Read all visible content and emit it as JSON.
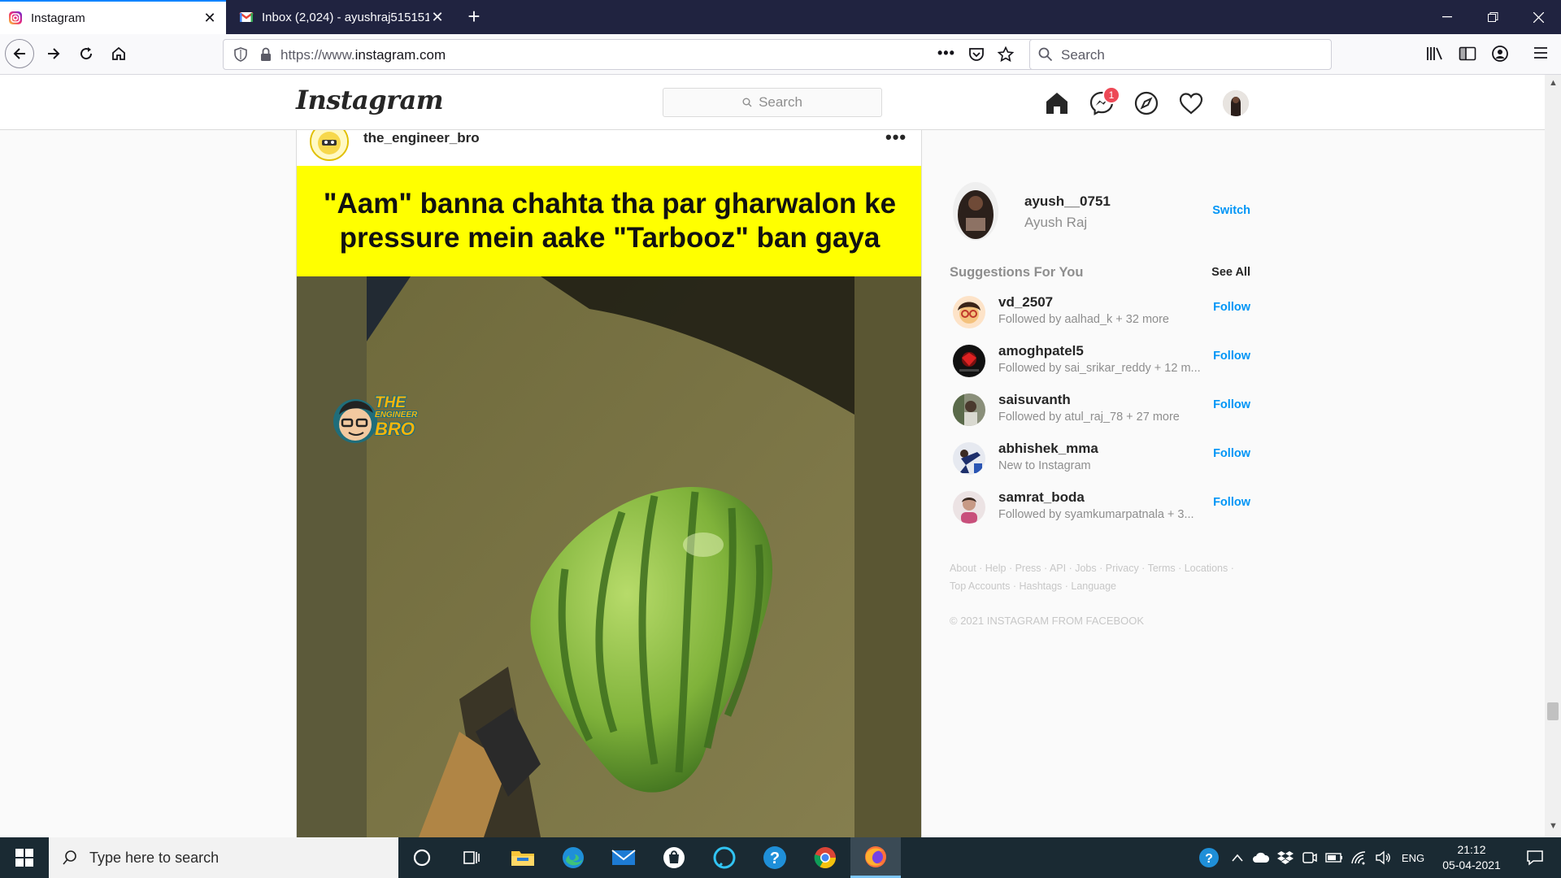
{
  "browser": {
    "tabs": [
      {
        "title": "Instagram",
        "active": true
      },
      {
        "title": "Inbox (2,024) - ayushraj515151@",
        "active": false
      }
    ],
    "url_prefix": "https://www.",
    "url_domain": "instagram.com",
    "search_placeholder": "Search"
  },
  "instagram": {
    "logo": "Instagram",
    "search_placeholder": "Search",
    "messages_badge": "1",
    "post": {
      "username": "the_engineer_bro",
      "more": "•••",
      "caption_line1": "\"Aam\" banna chahta tha par gharwalon ke",
      "caption_line2": "pressure mein aake \"Tarbooz\" ban gaya",
      "sticker_line1": "THE",
      "sticker_line2": "ENGINEER",
      "sticker_line3": "BRO"
    },
    "profile": {
      "username": "ayush__0751",
      "full_name": "Ayush Raj",
      "switch_label": "Switch"
    },
    "suggestions_title": "Suggestions For You",
    "see_all": "See All",
    "suggestions": [
      {
        "username": "vd_2507",
        "sub": "Followed by aalhad_k + 32 more",
        "action": "Follow"
      },
      {
        "username": "amoghpatel5",
        "sub": "Followed by sai_srikar_reddy + 12 m...",
        "action": "Follow"
      },
      {
        "username": "saisuvanth",
        "sub": "Followed by atul_raj_78 + 27 more",
        "action": "Follow"
      },
      {
        "username": "abhishek_mma",
        "sub": "New to Instagram",
        "action": "Follow"
      },
      {
        "username": "samrat_boda",
        "sub": "Followed by syamkumarpatnala + 3...",
        "action": "Follow"
      }
    ],
    "footer_line1": "About · Help · Press · API · Jobs · Privacy · Terms · Locations ·",
    "footer_line2": "Top Accounts · Hashtags · Language",
    "copyright": "© 2021 INSTAGRAM FROM FACEBOOK"
  },
  "taskbar": {
    "search_placeholder": "Type here to search",
    "language": "ENG",
    "time": "21:12",
    "date": "05-04-2021"
  },
  "colors": {
    "tabstrip": "#202340",
    "accent_blue": "#0095f6",
    "caption_yellow": "#ffff00",
    "badge_red": "#ed4956",
    "taskbar": "#1a2a33"
  }
}
